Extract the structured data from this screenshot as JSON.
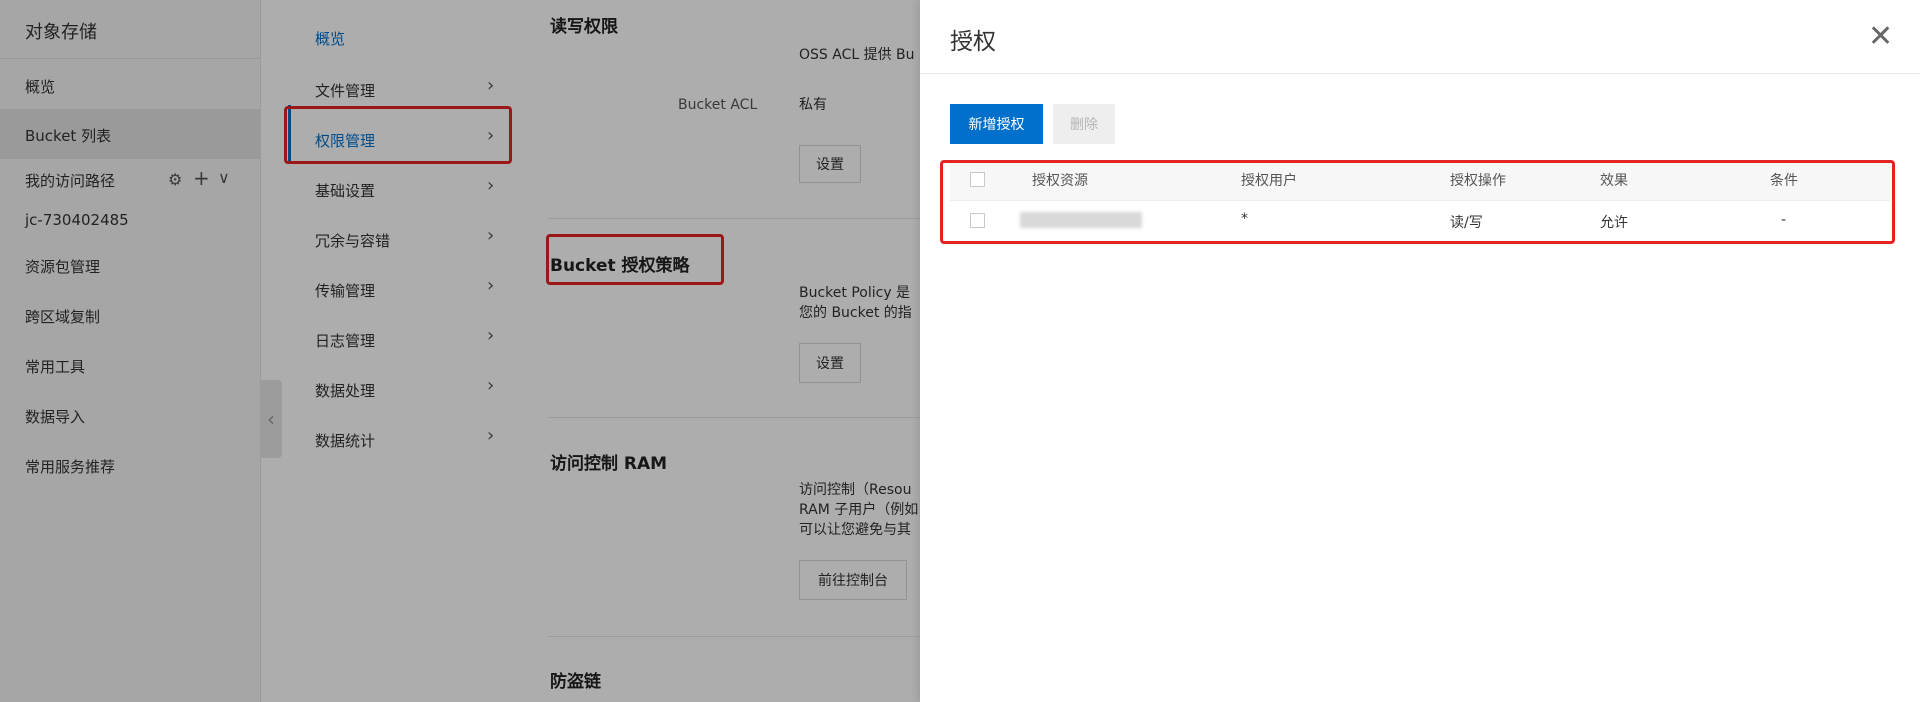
{
  "sidebar": {
    "title": "对象存储",
    "items": [
      {
        "label": "概览"
      },
      {
        "label": "Bucket 列表"
      },
      {
        "label": "我的访问路径"
      },
      {
        "label": "jc-730402485"
      },
      {
        "label": "资源包管理"
      },
      {
        "label": "跨区域复制"
      },
      {
        "label": "常用工具"
      },
      {
        "label": "数据导入"
      },
      {
        "label": "常用服务推荐"
      }
    ],
    "tools": {
      "gear": "⚙",
      "plus": "+",
      "chevron": "∨"
    }
  },
  "subnav": {
    "items": [
      {
        "label": "概览"
      },
      {
        "label": "文件管理"
      },
      {
        "label": "权限管理"
      },
      {
        "label": "基础设置"
      },
      {
        "label": "冗余与容错"
      },
      {
        "label": "传输管理"
      },
      {
        "label": "日志管理"
      },
      {
        "label": "数据处理"
      },
      {
        "label": "数据统计"
      }
    ],
    "chevron": "›"
  },
  "content": {
    "sec_rw_title": "读写权限",
    "oss_acl_desc": "OSS ACL 提供 Bu",
    "acl_label": "Bucket ACL",
    "acl_value": "私有",
    "set_label": "设置",
    "policy_title": "Bucket 授权策略",
    "policy_desc_1": "Bucket Policy 是",
    "policy_desc_2": "您的 Bucket 的指",
    "ram_title": "访问控制 RAM",
    "ram_desc_1": "访问控制（Resou",
    "ram_desc_2": "RAM 子用户（例如",
    "ram_desc_3": "可以让您避免与其",
    "console_button": "前往控制台",
    "hotlink_title": "防盗链"
  },
  "drawer": {
    "title": "授权",
    "close_glyph": "✕",
    "add_button": "新增授权",
    "delete_button": "删除",
    "table": {
      "headers": [
        "授权资源",
        "授权用户",
        "授权操作",
        "效果",
        "条件"
      ],
      "rows": [
        {
          "resource": "",
          "user": "*",
          "action": "读/写",
          "effect": "允许",
          "condition": "-"
        }
      ]
    }
  },
  "colors": {
    "primary": "#0070cc",
    "highlight": "#e62323",
    "overlay": "rgba(0,0,0,0.32)"
  }
}
